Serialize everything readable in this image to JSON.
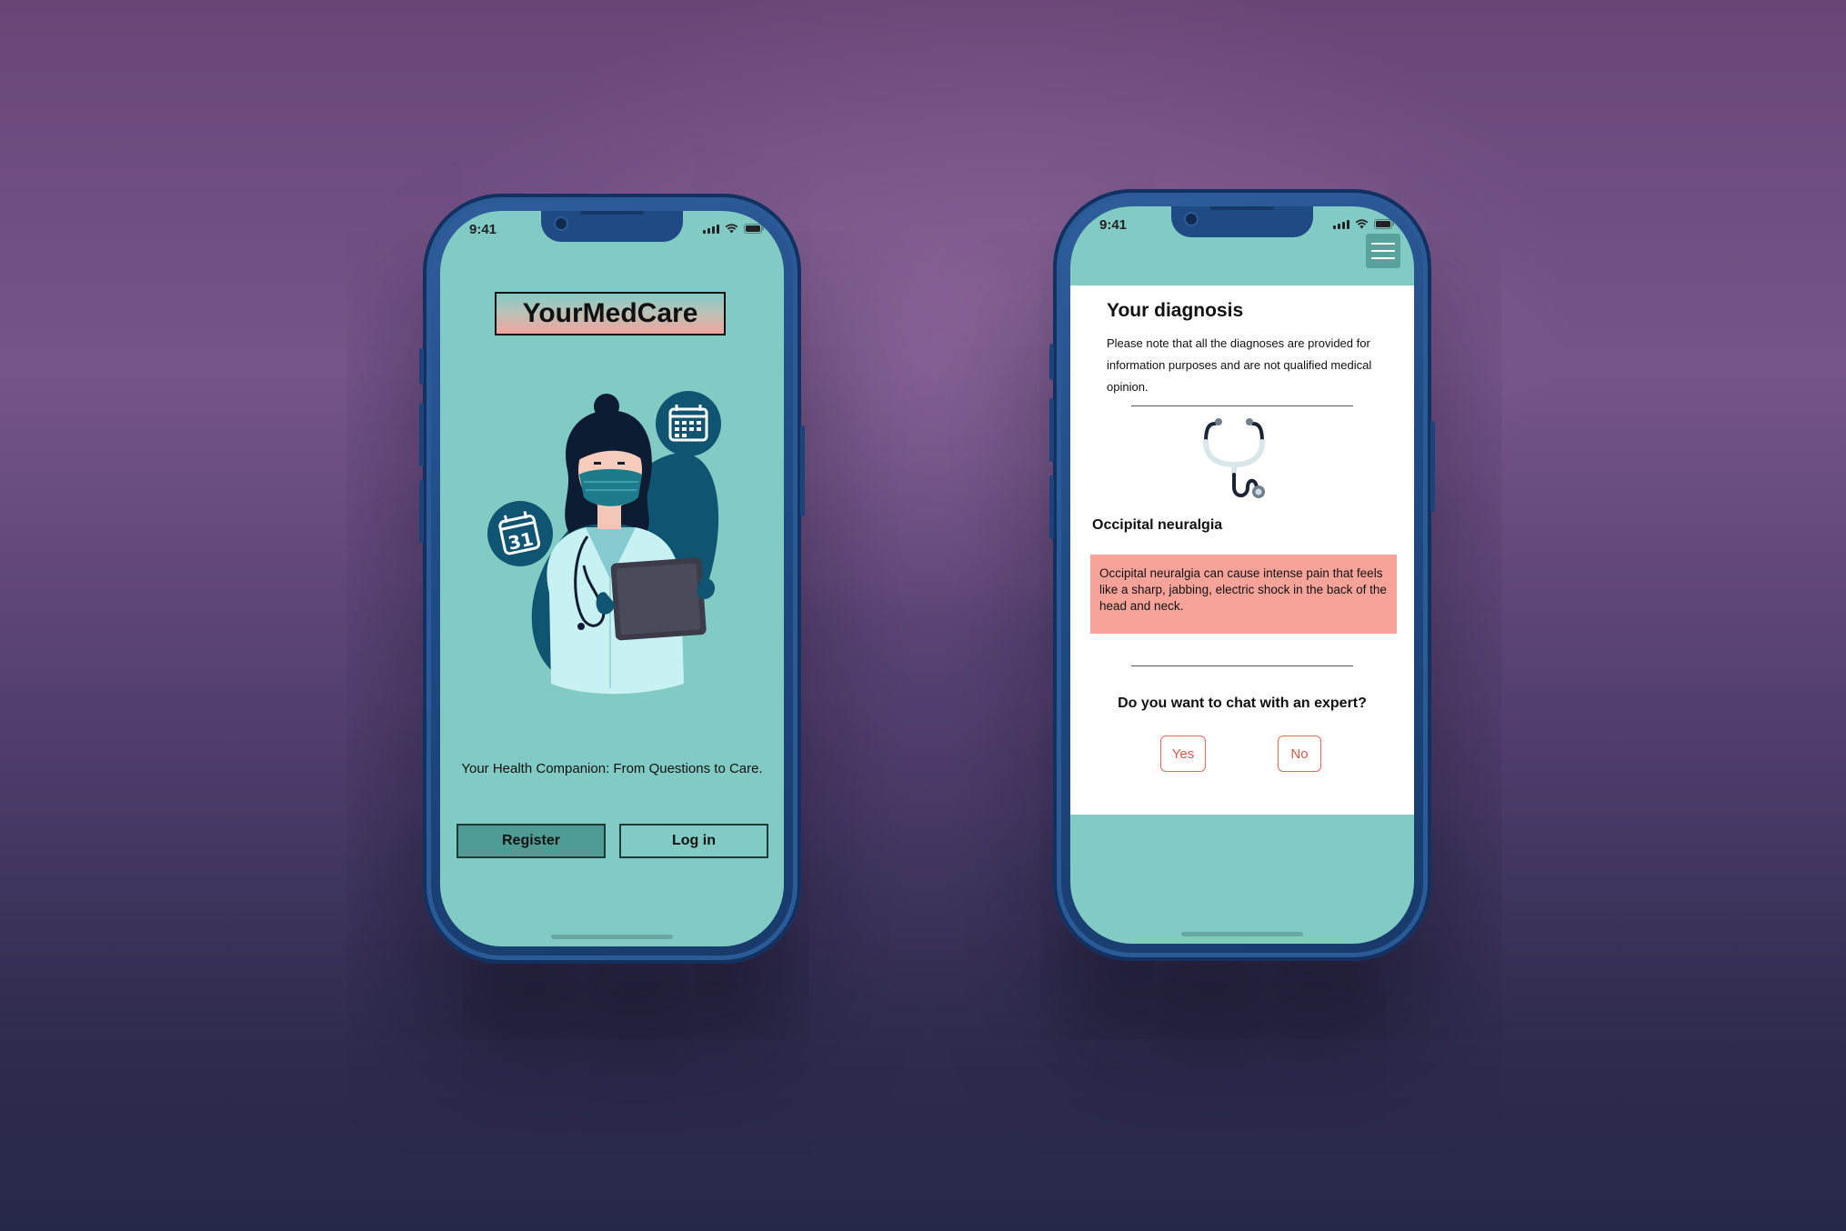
{
  "phone_left": {
    "status": {
      "time": "9:41"
    },
    "app_name": "YourMedCare",
    "tagline": "Your Health Companion: From Questions to Care.",
    "buttons": {
      "register": "Register",
      "login": "Log in"
    },
    "illustration": {
      "calendar_day": "31"
    }
  },
  "phone_right": {
    "status": {
      "time": "9:41"
    },
    "diagnosis": {
      "title": "Your diagnosis",
      "note": "Please note that all the diagnoses are provided for information purposes and are not qualified medical opinion.",
      "name": "Occipital neuralgia",
      "description": "Occipital neuralgia can cause intense pain that feels like a sharp, jabbing, electric shock in the back of the head and neck."
    },
    "chat": {
      "question": "Do you want to chat with an expert?",
      "yes": "Yes",
      "no": "No"
    }
  },
  "colors": {
    "screen_teal": "#82cbc5",
    "register_button": "#4f9c94",
    "description_box": "#f7a39a",
    "choice_accent": "#d9584a",
    "phone_frame": "#1f4a83"
  },
  "icons": [
    "signal-icon",
    "wifi-icon",
    "battery-icon",
    "menu-icon",
    "stethoscope-icon",
    "calendar-icon"
  ]
}
